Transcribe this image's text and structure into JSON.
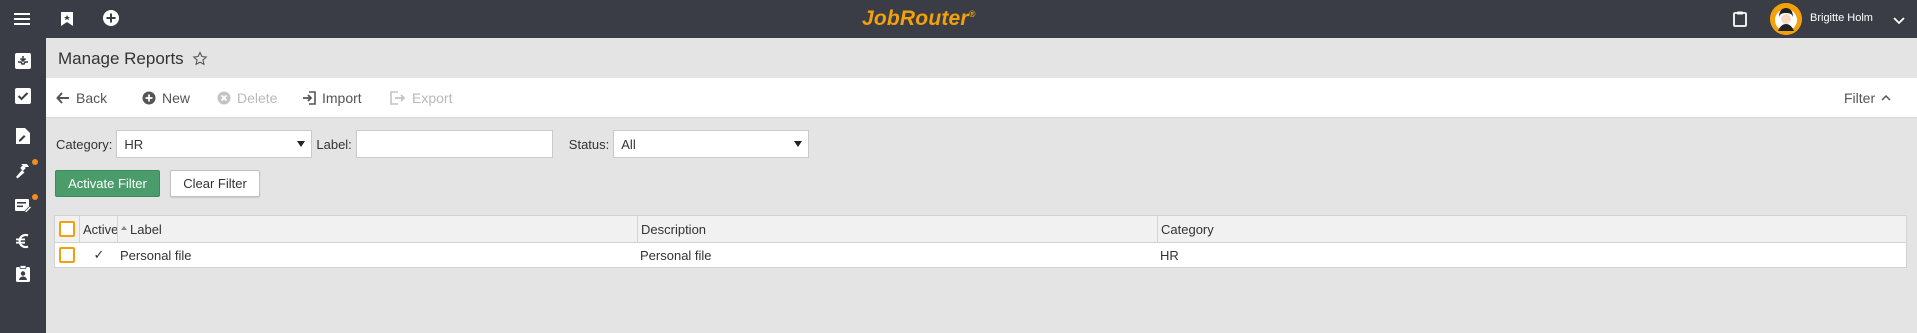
{
  "header": {
    "brand": "JobRouter",
    "brand_mark": "®",
    "user_name": "Brigitte Holm",
    "accent_color": "#f3a10b",
    "bar_color": "#3a3d46"
  },
  "sidebar": {
    "items": [
      {
        "icon": "inbox-icon"
      },
      {
        "icon": "check-box-icon"
      },
      {
        "icon": "document-pen-icon"
      },
      {
        "icon": "hammer-icon",
        "badge": true
      },
      {
        "icon": "form-pen-icon",
        "badge": true
      },
      {
        "icon": "euro-icon"
      },
      {
        "icon": "clipboard-user-icon"
      }
    ]
  },
  "page": {
    "title": "Manage Reports"
  },
  "toolbar": {
    "back": "Back",
    "new": "New",
    "delete": "Delete",
    "import": "Import",
    "export": "Export",
    "filter": "Filter"
  },
  "filters": {
    "category_label": "Category:",
    "category_value": "HR",
    "label_label": "Label:",
    "label_value": "",
    "status_label": "Status:",
    "status_value": "All",
    "activate_button": "Activate Filter",
    "clear_button": "Clear Filter"
  },
  "table": {
    "columns": [
      "Active",
      "Label",
      "Description",
      "Category"
    ],
    "rows": [
      {
        "active": "✓",
        "label": "Personal file",
        "description": "Personal file",
        "category": "HR"
      }
    ]
  }
}
